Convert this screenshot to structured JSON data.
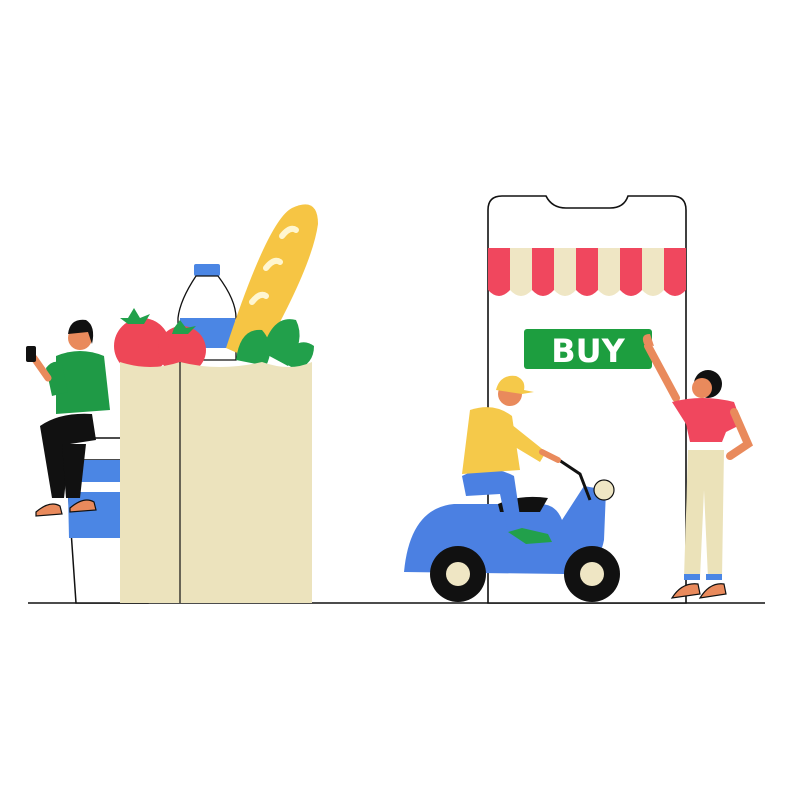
{
  "phone": {
    "buy_label": "BUY"
  },
  "colors": {
    "outline": "#111111",
    "awning_red": "#f0475e",
    "awning_cream": "#efe6c4",
    "buy_green": "#1d9e3f",
    "bag": "#ece3bd",
    "bread": "#f6c544",
    "tomato": "#ee4757",
    "leaf": "#22a04b",
    "bottle": "#4b86e4",
    "scooter_blue": "#4b80e2",
    "shirt_green": "#1f9a46",
    "shirt_yellow": "#f5c94a",
    "top_pink": "#f0475e",
    "pants_cream": "#ebe2b9",
    "skin": "#e98a5c"
  }
}
